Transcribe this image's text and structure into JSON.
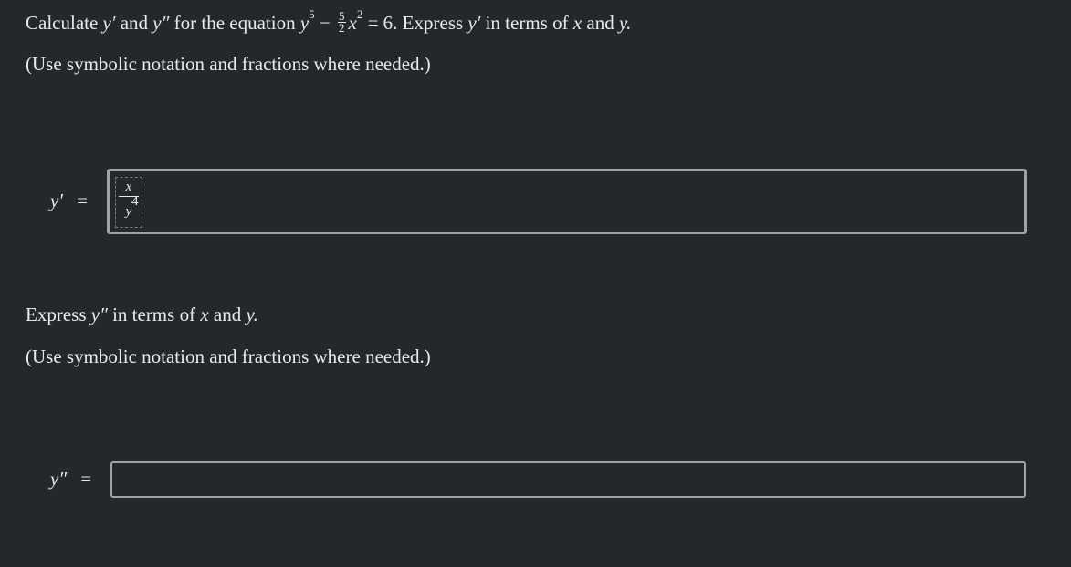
{
  "question": {
    "prefix": "Calculate",
    "yprime": "y′",
    "and": "and",
    "ydoubleprime": "y″",
    "for_the_equation": "for the equation",
    "y": "y",
    "exp5": "5",
    "minus": "−",
    "frac_num": "5",
    "frac_den": "2",
    "x": "x",
    "exp2": "2",
    "equals_six": "= 6.",
    "express": "Express",
    "in_terms_of": "in terms of",
    "var_x": "x",
    "and2": "and",
    "var_y_period": "y."
  },
  "hint1": "(Use symbolic notation and fractions where needed.)",
  "answer1": {
    "label": "y′",
    "equals": "=",
    "value_num": "x",
    "value_den": "y",
    "value_den_exp": "4"
  },
  "question2": {
    "express": "Express",
    "ydoubleprime": "y″",
    "in_terms_of": "in terms of",
    "var_x": "x",
    "and": "and",
    "var_y_period": "y."
  },
  "hint2": "(Use symbolic notation and fractions where needed.)",
  "answer2": {
    "label": "y″",
    "equals": "=",
    "value": ""
  }
}
